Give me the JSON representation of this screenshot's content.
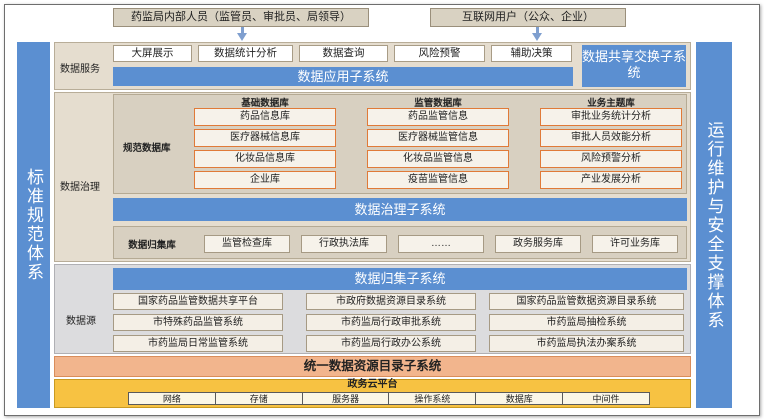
{
  "users": {
    "internal": "药监局内部人员（监管员、审批员、局领导）",
    "external": "互联网用户（公众、企业）"
  },
  "side": {
    "left": "标准规范体系",
    "right": "运行维护与安全支撑体系"
  },
  "app_layer": {
    "label": "数据服务",
    "services": [
      "大屏展示",
      "数据统计分析",
      "数据查询",
      "风险预警",
      "辅助决策"
    ],
    "bar": "数据应用子系统",
    "exchange": "数据共享交换子系统"
  },
  "governance": {
    "label": "数据治理",
    "standard_label": "规范数据库",
    "groups": [
      {
        "title": "基础数据库",
        "items": [
          "药品信息库",
          "医疗器械信息库",
          "化妆品信息库",
          "企业库"
        ]
      },
      {
        "title": "监管数据库",
        "items": [
          "药品监管信息",
          "医疗器械监管信息",
          "化妆品监管信息",
          "疫苗监管信息"
        ]
      },
      {
        "title": "业务主题库",
        "items": [
          "审批业务统计分析",
          "审批人员效能分析",
          "风险预警分析",
          "产业发展分析"
        ]
      }
    ],
    "bar": "数据治理子系统",
    "collect_label": "数据归集库",
    "collect_items": [
      "监管检查库",
      "行政执法库",
      "……",
      "政务服务库",
      "许可业务库"
    ]
  },
  "source": {
    "label": "数据源",
    "bar": "数据归集子系统",
    "rows": [
      [
        "国家药品监管数据共享平台",
        "市政府数据资源目录系统",
        "国家药品监管数据资源目录系统"
      ],
      [
        "市特殊药品监管系统",
        "市药监局行政审批系统",
        "市药监局抽检系统"
      ],
      [
        "市药监局日常监管系统",
        "市药监局行政办公系统",
        "市药监局执法办案系统"
      ]
    ]
  },
  "catalog_bar": "统一数据资源目录子系统",
  "platform": {
    "title": "政务云平台",
    "items": [
      "网络",
      "存储",
      "服务器",
      "操作系统",
      "数据库",
      "中间件"
    ]
  }
}
